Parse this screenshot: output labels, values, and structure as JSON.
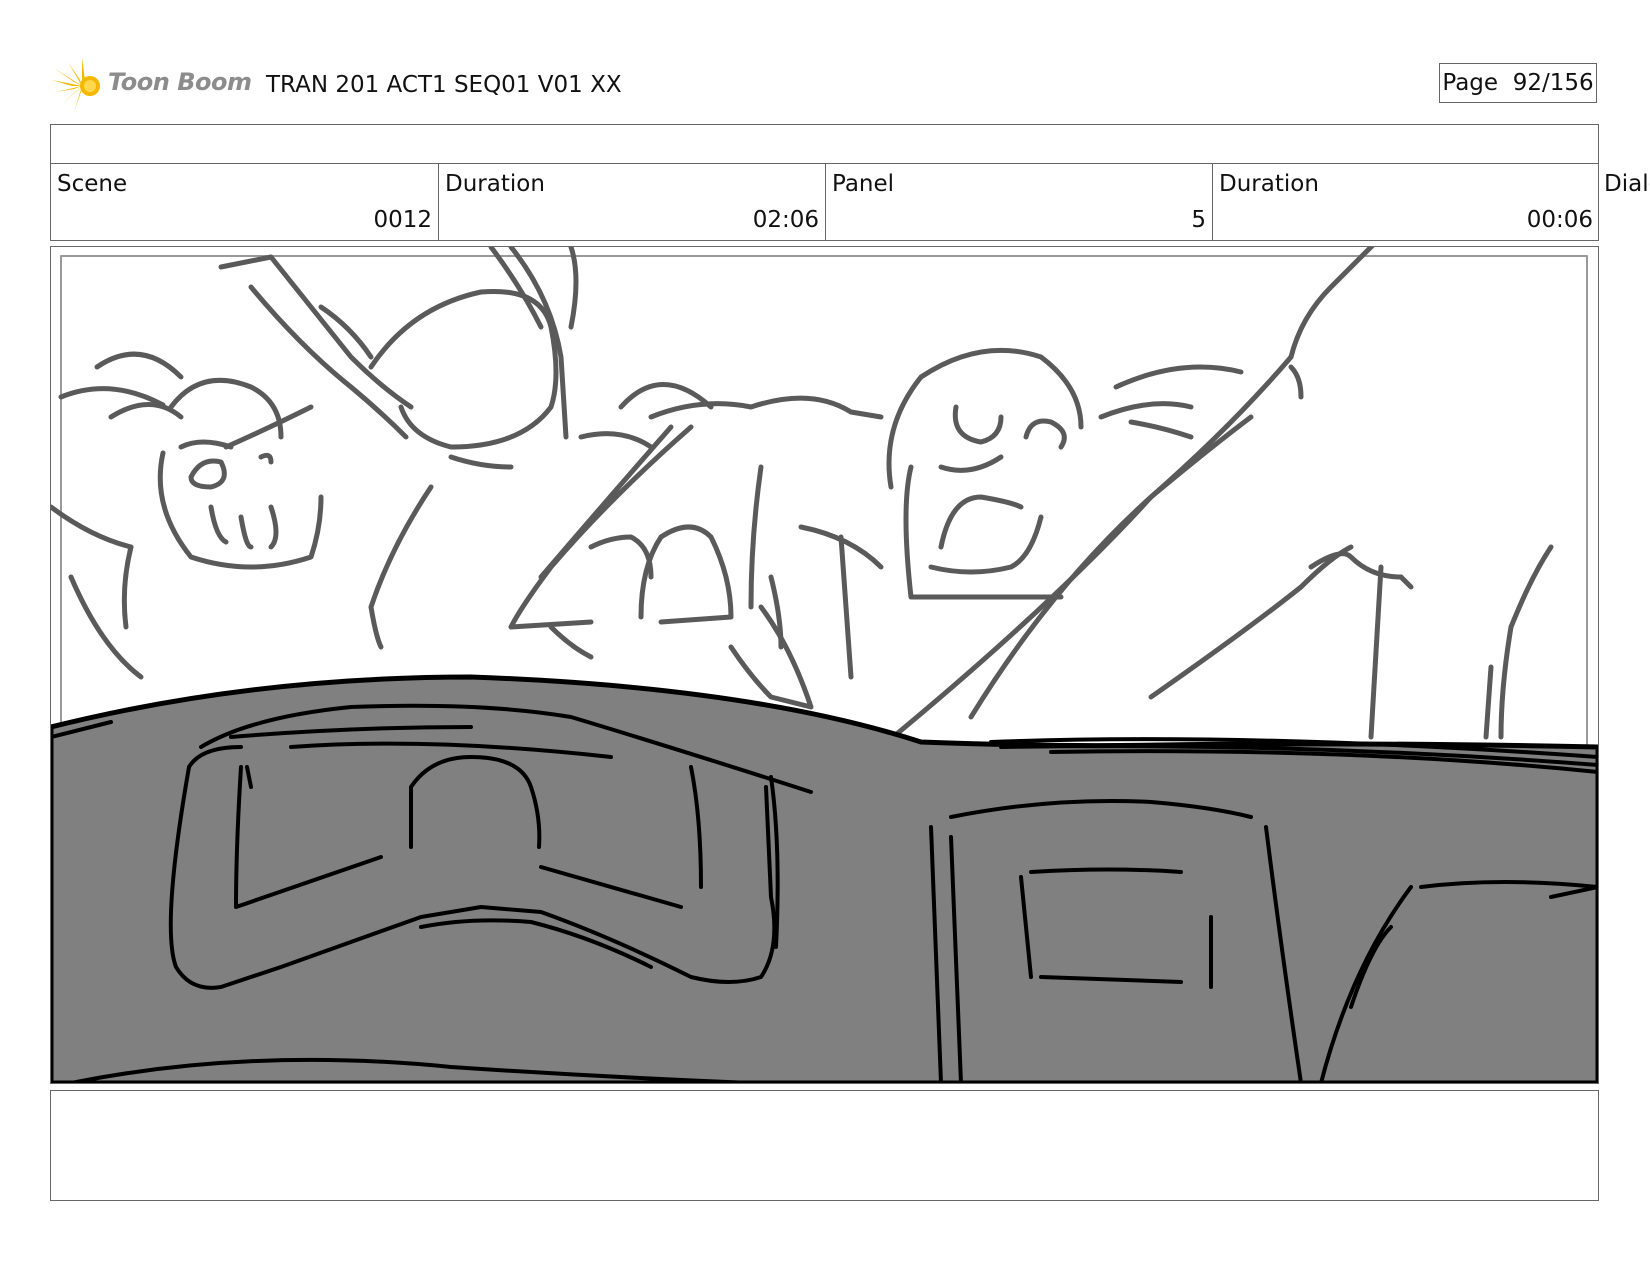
{
  "header": {
    "logo_text": "Toon Boom",
    "title": "TRAN 201 ACT1 SEQ01 V01 XX",
    "page_label": "Page",
    "page_value": "92/156"
  },
  "info": {
    "scene_label": "Scene",
    "scene_value": "0012",
    "duration_label": "Duration",
    "duration_value": "02:06",
    "panel_label": "Panel",
    "panel_value": "5",
    "panel_duration_label": "Duration",
    "panel_duration_value": "00:06",
    "dialog_label": "Dialog"
  },
  "colors": {
    "logo_accent": "#f5b800",
    "sketch_line": "#5a5a5a",
    "foreground_fill": "#808080"
  },
  "icons": {
    "logo": "toon-boom-starburst-icon"
  }
}
